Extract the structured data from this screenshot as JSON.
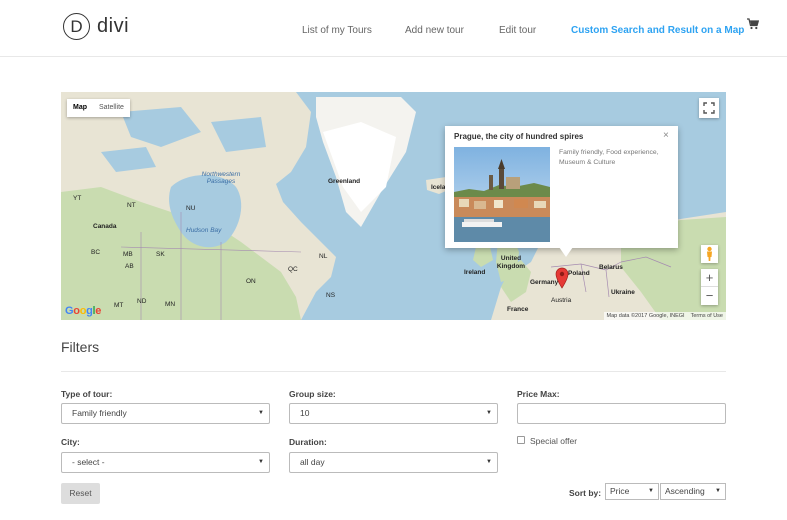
{
  "header": {
    "logo_letter": "D",
    "logo_text": "divi",
    "nav": [
      {
        "label": "List of my Tours",
        "active": false
      },
      {
        "label": "Add new tour",
        "active": false
      },
      {
        "label": "Edit tour",
        "active": false
      },
      {
        "label": "Custom Search and Result on a Map",
        "active": true
      }
    ],
    "cart_icon": "cart-icon"
  },
  "map": {
    "type_buttons": [
      "Map",
      "Satellite"
    ],
    "selected_type": "Map",
    "labels": {
      "greenland": "Greenland",
      "iceland": "Icela",
      "northwestern_passages": "Northwestern Passages",
      "hudson_bay": "Hudson Bay",
      "canada": "Canada",
      "ireland": "Ireland",
      "united_kingdom": "United Kingdom",
      "poland": "Poland",
      "belarus": "Belarus",
      "germany": "Germany",
      "ukraine": "Ukraine",
      "france": "France",
      "austria": "Austria",
      "ab": "AB",
      "sk": "SK",
      "mb": "MB",
      "on": "ON",
      "qc": "QC",
      "nl": "NL",
      "bc": "BC",
      "mt": "MT",
      "nd": "ND",
      "mn": "MN",
      "nu": "NU",
      "nt": "NT",
      "yt": "YT",
      "ns": "NS"
    },
    "google": "Google",
    "attribution": {
      "map_data": "Map data ©2017 Google, INEGI",
      "terms": "Terms of Use"
    },
    "zoom_in": "+",
    "zoom_out": "−",
    "infowindow": {
      "title": "Prague, the city of hundred spires",
      "description": "Family friendly, Food experience, Museum & Culture",
      "close": "×"
    }
  },
  "filters": {
    "title": "Filters",
    "type_of_tour": {
      "label": "Type of tour:",
      "value": "Family friendly"
    },
    "group_size": {
      "label": "Group size:",
      "value": "10"
    },
    "price_max": {
      "label": "Price Max:",
      "value": ""
    },
    "city": {
      "label": "City:",
      "value": "- select -"
    },
    "duration": {
      "label": "Duration:",
      "value": "all day"
    },
    "special_offer": {
      "label": "Special offer",
      "checked": false
    },
    "reset_label": "Reset",
    "sort": {
      "label": "Sort by:",
      "field": "Price",
      "order": "Ascending"
    }
  },
  "colors": {
    "accent": "#2ea3f2",
    "water": "#a7cbe0",
    "land": "#e8e4d4",
    "forest": "#c9dcb0"
  }
}
